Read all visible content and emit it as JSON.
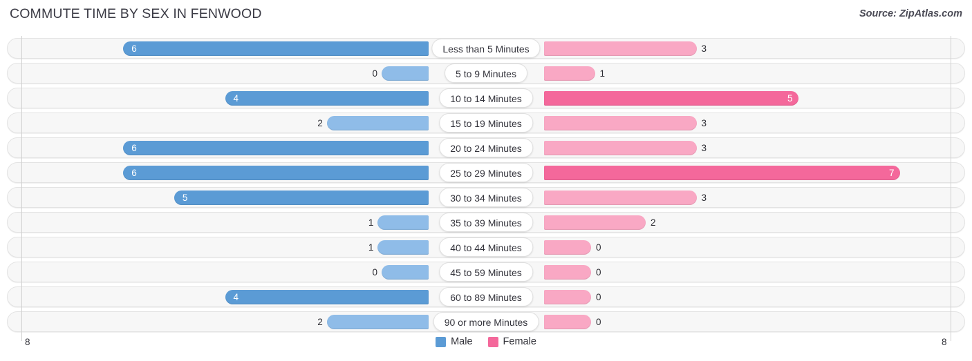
{
  "header": {
    "title": "COMMUTE TIME BY SEX IN FENWOOD",
    "source": "Source: ZipAtlas.com"
  },
  "legend": {
    "male_label": "Male",
    "female_label": "Female"
  },
  "axis": {
    "left_max_label": "8",
    "right_max_label": "8"
  },
  "colors": {
    "male_strong": "#5b9bd5",
    "male_light": "#8fbce8",
    "female_strong": "#f4689b",
    "female_light": "#f9a8c4",
    "track": "#f7f7f7",
    "gridline": "#d0d0d0",
    "title": "#3c3c46"
  },
  "chart_data": {
    "type": "bar",
    "subtype": "diverging-bar",
    "title": "COMMUTE TIME BY SEX IN FENWOOD",
    "xlabel": "",
    "ylabel": "",
    "xlim": [
      8,
      8
    ],
    "grid": true,
    "legend_position": "bottom-center",
    "categories": [
      "Less than 5 Minutes",
      "5 to 9 Minutes",
      "10 to 14 Minutes",
      "15 to 19 Minutes",
      "20 to 24 Minutes",
      "25 to 29 Minutes",
      "30 to 34 Minutes",
      "35 to 39 Minutes",
      "40 to 44 Minutes",
      "45 to 59 Minutes",
      "60 to 89 Minutes",
      "90 or more Minutes"
    ],
    "series": [
      {
        "name": "Male",
        "side": "left",
        "color": "#5b9bd5",
        "values": [
          6,
          0,
          4,
          2,
          6,
          6,
          5,
          1,
          1,
          0,
          4,
          2
        ]
      },
      {
        "name": "Female",
        "side": "right",
        "color": "#f4689b",
        "values": [
          3,
          1,
          5,
          3,
          3,
          7,
          3,
          2,
          0,
          0,
          0,
          0
        ]
      }
    ]
  },
  "rows": [
    {
      "label": "Less than 5 Minutes",
      "male": 6,
      "female": 3,
      "male_text": "6",
      "female_text": "3"
    },
    {
      "label": "5 to 9 Minutes",
      "male": 0,
      "female": 1,
      "male_text": "0",
      "female_text": "1"
    },
    {
      "label": "10 to 14 Minutes",
      "male": 4,
      "female": 5,
      "male_text": "4",
      "female_text": "5"
    },
    {
      "label": "15 to 19 Minutes",
      "male": 2,
      "female": 3,
      "male_text": "2",
      "female_text": "3"
    },
    {
      "label": "20 to 24 Minutes",
      "male": 6,
      "female": 3,
      "male_text": "6",
      "female_text": "3"
    },
    {
      "label": "25 to 29 Minutes",
      "male": 6,
      "female": 7,
      "male_text": "6",
      "female_text": "7"
    },
    {
      "label": "30 to 34 Minutes",
      "male": 5,
      "female": 3,
      "male_text": "5",
      "female_text": "3"
    },
    {
      "label": "35 to 39 Minutes",
      "male": 1,
      "female": 2,
      "male_text": "1",
      "female_text": "2"
    },
    {
      "label": "40 to 44 Minutes",
      "male": 1,
      "female": 0,
      "male_text": "1",
      "female_text": "0"
    },
    {
      "label": "45 to 59 Minutes",
      "male": 0,
      "female": 0,
      "male_text": "0",
      "female_text": "0"
    },
    {
      "label": "60 to 89 Minutes",
      "male": 4,
      "female": 0,
      "male_text": "4",
      "female_text": "0"
    },
    {
      "label": "90 or more Minutes",
      "male": 2,
      "female": 0,
      "male_text": "2",
      "female_text": "0"
    }
  ]
}
